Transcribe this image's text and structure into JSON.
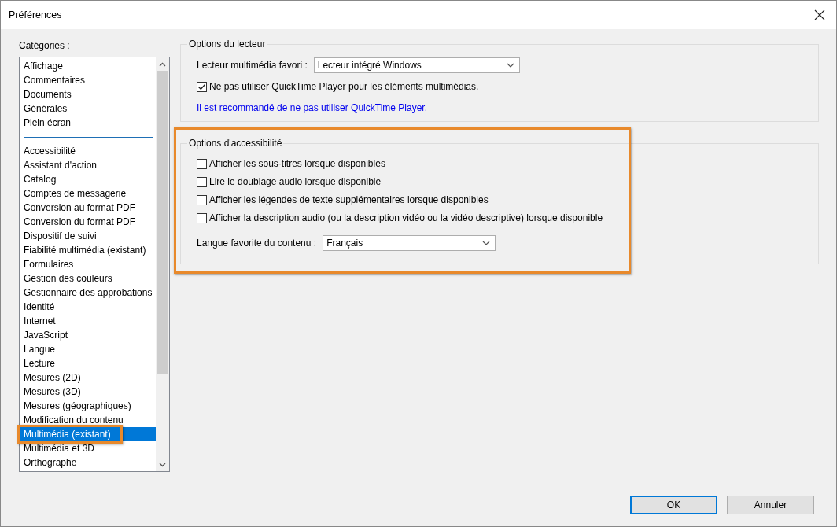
{
  "window": {
    "title": "Préférences"
  },
  "categories": {
    "label": "Catégories :",
    "groups": [
      {
        "items": [
          {
            "label": "Affichage",
            "selected": false,
            "highlighted": false
          },
          {
            "label": "Commentaires",
            "selected": false,
            "highlighted": false
          },
          {
            "label": "Documents",
            "selected": false,
            "highlighted": false
          },
          {
            "label": "Générales",
            "selected": false,
            "highlighted": false
          },
          {
            "label": "Plein écran",
            "selected": false,
            "highlighted": false
          }
        ]
      },
      {
        "items": [
          {
            "label": "Accessibilité",
            "selected": false,
            "highlighted": false
          },
          {
            "label": "Assistant d'action",
            "selected": false,
            "highlighted": false
          },
          {
            "label": "Catalog",
            "selected": false,
            "highlighted": false
          },
          {
            "label": "Comptes de messagerie",
            "selected": false,
            "highlighted": false
          },
          {
            "label": "Conversion au format PDF",
            "selected": false,
            "highlighted": false
          },
          {
            "label": "Conversion du format PDF",
            "selected": false,
            "highlighted": false
          },
          {
            "label": "Dispositif de suivi",
            "selected": false,
            "highlighted": false
          },
          {
            "label": "Fiabilité multimédia (existant)",
            "selected": false,
            "highlighted": false
          },
          {
            "label": "Formulaires",
            "selected": false,
            "highlighted": false
          },
          {
            "label": "Gestion des couleurs",
            "selected": false,
            "highlighted": false
          },
          {
            "label": "Gestionnaire des approbations",
            "selected": false,
            "highlighted": false
          },
          {
            "label": "Identité",
            "selected": false,
            "highlighted": false
          },
          {
            "label": "Internet",
            "selected": false,
            "highlighted": false
          },
          {
            "label": "JavaScript",
            "selected": false,
            "highlighted": false
          },
          {
            "label": "Langue",
            "selected": false,
            "highlighted": false
          },
          {
            "label": "Lecture",
            "selected": false,
            "highlighted": false
          },
          {
            "label": "Mesures (2D)",
            "selected": false,
            "highlighted": false
          },
          {
            "label": "Mesures (3D)",
            "selected": false,
            "highlighted": false
          },
          {
            "label": "Mesures (géographiques)",
            "selected": false,
            "highlighted": false
          },
          {
            "label": "Modification du contenu",
            "selected": false,
            "highlighted": false
          },
          {
            "label": "Multimédia (existant)",
            "selected": true,
            "highlighted": true
          },
          {
            "label": "Multimédia et 3D",
            "selected": false,
            "highlighted": false
          },
          {
            "label": "Orthographe",
            "selected": false,
            "highlighted": false
          }
        ]
      }
    ]
  },
  "player_options": {
    "title": "Options du lecteur",
    "player_label": "Lecteur multimédia favori :",
    "player_value": "Lecteur intégré Windows",
    "quicktime": {
      "label": "Ne pas utiliser QuickTime Player pour les éléments multimédias.",
      "checked": true
    },
    "link": "Il est recommandé de ne pas utiliser QuickTime Player."
  },
  "accessibility_options": {
    "title": "Options d'accessibilité",
    "highlighted": true,
    "checkboxes": [
      {
        "label": "Afficher les sous-titres lorsque disponibles",
        "checked": false
      },
      {
        "label": "Lire le doublage audio lorsque disponible",
        "checked": false
      },
      {
        "label": "Afficher les légendes de texte supplémentaires lorsque disponibles",
        "checked": false
      },
      {
        "label": "Afficher la description audio (ou la description vidéo ou la vidéo descriptive) lorsque disponible",
        "checked": false
      }
    ],
    "language_label": "Langue favorite du contenu :",
    "language_value": "Français"
  },
  "buttons": [
    {
      "label": "OK",
      "default": true
    },
    {
      "label": "Annuler",
      "default": false
    }
  ]
}
